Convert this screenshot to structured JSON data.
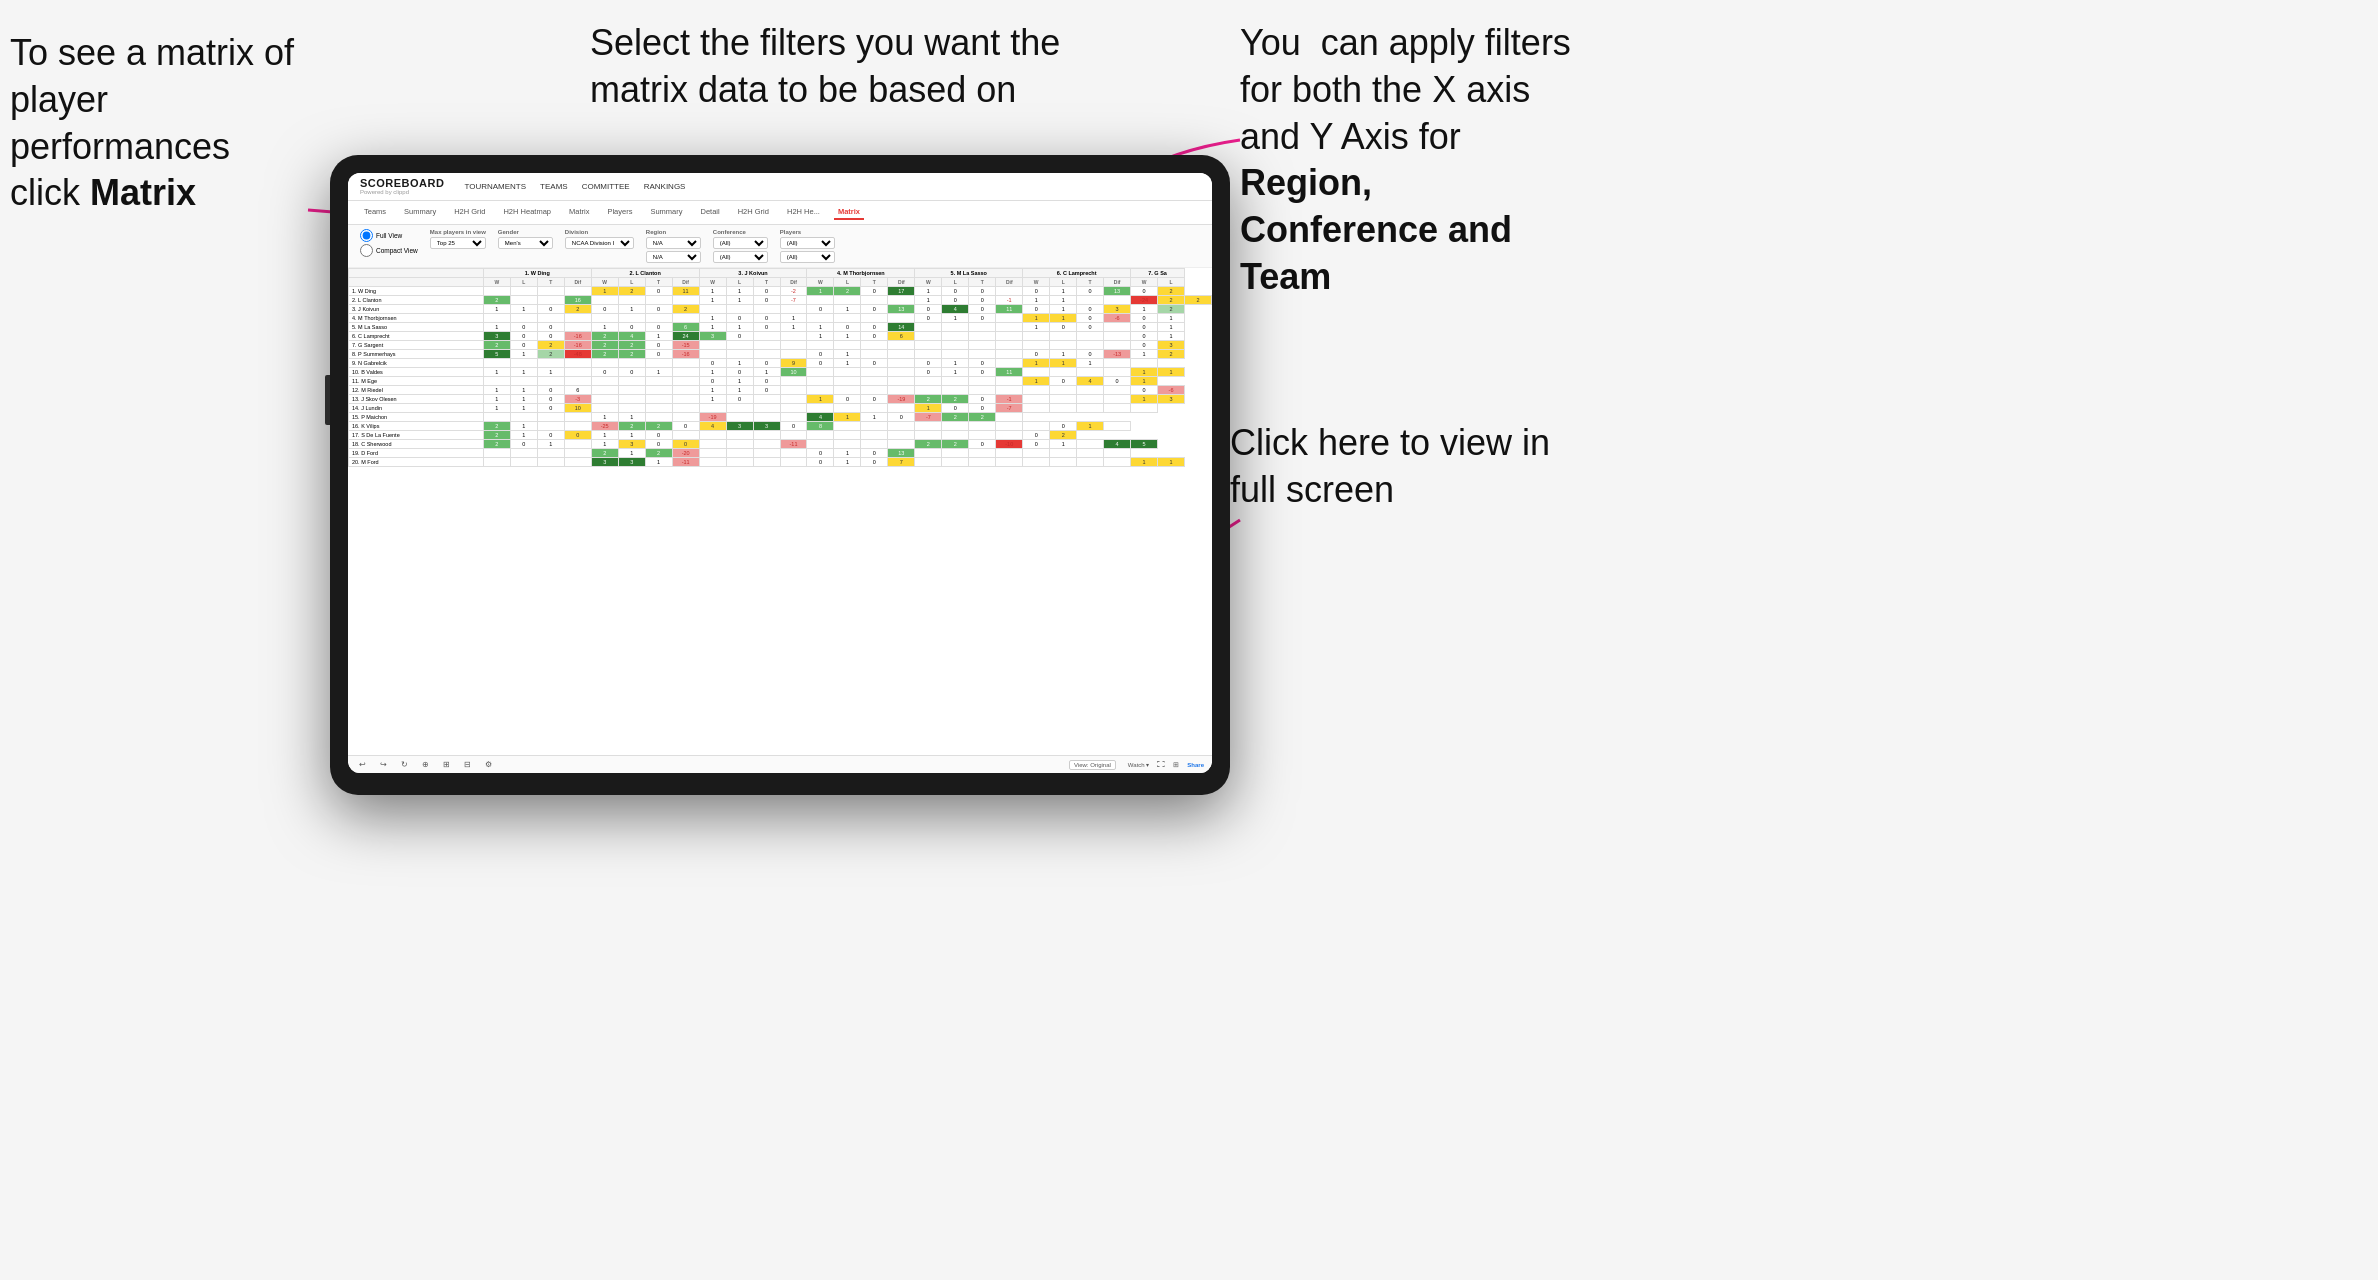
{
  "annotations": {
    "left": {
      "line1": "To see a matrix of",
      "line2": "player performances",
      "line3_pre": "click ",
      "line3_bold": "Matrix"
    },
    "center": {
      "text": "Select the filters you want the matrix data to be based on"
    },
    "right": {
      "line1": "You  can apply filters for both the X axis and Y Axis for ",
      "bold1": "Region, Conference and Team"
    },
    "bottom_right": {
      "text": "Click here to view in full screen"
    }
  },
  "app": {
    "logo": "SCOREBOARD",
    "powered_by": "Powered by clippd",
    "nav": [
      "TOURNAMENTS",
      "TEAMS",
      "COMMITTEE",
      "RANKINGS"
    ]
  },
  "sub_nav": {
    "tabs": [
      "Teams",
      "Summary",
      "H2H Grid",
      "H2H Heatmap",
      "Matrix",
      "Players",
      "Summary",
      "Detail",
      "H2H Grid",
      "H2H He...",
      "Matrix"
    ]
  },
  "filters": {
    "view_options": [
      "Full View",
      "Compact View"
    ],
    "max_players": {
      "label": "Max players in view",
      "value": "Top 25"
    },
    "gender": {
      "label": "Gender",
      "value": "Men's"
    },
    "division": {
      "label": "Division",
      "value": "NCAA Division I"
    },
    "region": {
      "label": "Region",
      "value1": "N/A",
      "value2": "N/A"
    },
    "conference": {
      "label": "Conference",
      "value1": "(All)",
      "value2": "(All)"
    },
    "players": {
      "label": "Players",
      "value1": "(All)",
      "value2": "(All)"
    }
  },
  "matrix": {
    "column_headers": [
      "1. W Ding",
      "2. L Clanton",
      "3. J Koivun",
      "4. M Thorbjornsen",
      "5. M La Sasso",
      "6. C Lamprecht",
      "7. G Sa"
    ],
    "sub_headers": [
      "W",
      "L",
      "T",
      "Dif"
    ],
    "rows": [
      {
        "name": "1. W Ding",
        "cells": [
          "",
          "",
          "",
          "",
          "1",
          "2",
          "0",
          "11",
          "1",
          "1",
          "0",
          "-2",
          "1",
          "2",
          "0",
          "17",
          "1",
          "0",
          "0",
          "",
          "0",
          "1",
          "0",
          "13",
          "0",
          "2"
        ]
      },
      {
        "name": "2. L Clanton",
        "cells": [
          "2",
          "",
          "",
          "16",
          "",
          "",
          "",
          "",
          "1",
          "1",
          "0",
          "-7",
          "",
          "",
          "",
          "",
          "1",
          "0",
          "0",
          "-1",
          "1",
          "1",
          "",
          "",
          "-24",
          "2",
          "2"
        ]
      },
      {
        "name": "3. J Koivun",
        "cells": [
          "1",
          "1",
          "0",
          "2",
          "0",
          "1",
          "0",
          "2",
          "",
          "",
          "",
          "",
          "0",
          "1",
          "0",
          "13",
          "0",
          "4",
          "0",
          "11",
          "0",
          "1",
          "0",
          "3",
          "1",
          "2"
        ]
      },
      {
        "name": "4. M Thorbjornsen",
        "cells": [
          "",
          "",
          "",
          "",
          "",
          "",
          "",
          "",
          "1",
          "0",
          "0",
          "1",
          "",
          "",
          "",
          "",
          "0",
          "1",
          "0",
          "",
          "1",
          "1",
          "0",
          "-6",
          "0",
          "1"
        ]
      },
      {
        "name": "5. M La Sasso",
        "cells": [
          "1",
          "0",
          "0",
          "",
          "1",
          "0",
          "0",
          "6",
          "1",
          "1",
          "0",
          "1",
          "1",
          "0",
          "0",
          "14",
          "",
          "",
          "",
          "",
          "1",
          "0",
          "0",
          "",
          "0",
          "1"
        ]
      },
      {
        "name": "6. C Lamprecht",
        "cells": [
          "3",
          "0",
          "0",
          "-16",
          "2",
          "4",
          "1",
          "24",
          "3",
          "0",
          "",
          "",
          "1",
          "1",
          "0",
          "6",
          "",
          "",
          "",
          "",
          "",
          "",
          "",
          "",
          "0",
          "1"
        ]
      },
      {
        "name": "7. G Sargent",
        "cells": [
          "2",
          "0",
          "2",
          "-16",
          "2",
          "2",
          "0",
          "-15",
          "",
          "",
          "",
          "",
          "",
          "",
          "",
          "",
          "",
          "",
          "",
          "",
          "",
          "",
          "",
          "",
          "0",
          "3"
        ]
      },
      {
        "name": "8. P Summerhays",
        "cells": [
          "5",
          "1",
          "2",
          "-48",
          "2",
          "2",
          "0",
          "-16",
          "",
          "",
          "",
          "",
          "0",
          "1",
          "",
          "",
          "",
          "",
          "",
          "",
          "0",
          "1",
          "0",
          "-13",
          "1",
          "2"
        ]
      },
      {
        "name": "9. N Gabrelcik",
        "cells": [
          "",
          "",
          "",
          "",
          "",
          "",
          "",
          "",
          "0",
          "1",
          "0",
          "9",
          "0",
          "1",
          "0",
          "",
          "0",
          "1",
          "0",
          "",
          "1",
          "1",
          "1",
          "",
          ""
        ]
      },
      {
        "name": "10. B Valdes",
        "cells": [
          "1",
          "1",
          "1",
          "",
          "0",
          "0",
          "1",
          "",
          "1",
          "0",
          "1",
          "10",
          "",
          "",
          "",
          "",
          "0",
          "1",
          "0",
          "11",
          "",
          "",
          "",
          "",
          "1",
          "1"
        ]
      },
      {
        "name": "11. M Ege",
        "cells": [
          "",
          "",
          "",
          "",
          "",
          "",
          "",
          "",
          "0",
          "1",
          "0",
          "",
          "",
          "",
          "",
          "",
          "",
          "",
          "",
          "",
          "1",
          "0",
          "4",
          "0",
          "1"
        ]
      },
      {
        "name": "12. M Riedel",
        "cells": [
          "1",
          "1",
          "0",
          "6",
          "",
          "",
          "",
          "",
          "1",
          "1",
          "0",
          "",
          "",
          "",
          "",
          "",
          "",
          "",
          "",
          "",
          "",
          "",
          "",
          "",
          "0",
          "-6"
        ]
      },
      {
        "name": "13. J Skov Olesen",
        "cells": [
          "1",
          "1",
          "0",
          "-3",
          "",
          "",
          "",
          "",
          "1",
          "0",
          "",
          "",
          "1",
          "0",
          "0",
          "-19",
          "2",
          "2",
          "0",
          "-1",
          "",
          "",
          "",
          "",
          "1",
          "3"
        ]
      },
      {
        "name": "14. J Lundin",
        "cells": [
          "1",
          "1",
          "0",
          "10",
          "",
          "",
          "",
          "",
          "",
          "",
          "",
          "",
          "",
          "",
          "",
          "",
          "1",
          "0",
          "0",
          "-7",
          "",
          "",
          "",
          "",
          ""
        ]
      },
      {
        "name": "15. P Maichon",
        "cells": [
          "",
          "",
          "",
          "",
          "1",
          "1",
          "",
          "",
          "-19",
          "",
          "",
          "",
          "4",
          "1",
          "1",
          "0",
          "-7",
          "2",
          "2",
          ""
        ]
      },
      {
        "name": "16. K Vilips",
        "cells": [
          "2",
          "1",
          "",
          "",
          "-25",
          "2",
          "2",
          "0",
          "4",
          "3",
          "3",
          "0",
          "8",
          "",
          "",
          "",
          "",
          "",
          "",
          "",
          "",
          "0",
          "1",
          ""
        ]
      },
      {
        "name": "17. S De La Fuente",
        "cells": [
          "2",
          "1",
          "0",
          "0",
          "1",
          "1",
          "0",
          "",
          "",
          "",
          "",
          "",
          "",
          "",
          "",
          "",
          "",
          "",
          "",
          "",
          "0",
          "2"
        ]
      },
      {
        "name": "18. C Sherwood",
        "cells": [
          "2",
          "0",
          "1",
          "",
          "1",
          "3",
          "0",
          "0",
          "",
          "",
          "",
          "-11",
          "",
          "",
          "",
          "",
          "2",
          "2",
          "0",
          "-10",
          "0",
          "1",
          "",
          "4",
          "5"
        ]
      },
      {
        "name": "19. D Ford",
        "cells": [
          "",
          "",
          "",
          "",
          "2",
          "1",
          "2",
          "-20",
          "",
          "",
          "",
          "",
          "0",
          "1",
          "0",
          "13",
          "",
          "",
          "",
          "",
          "",
          "",
          "",
          ""
        ]
      },
      {
        "name": "20. M Ford",
        "cells": [
          "",
          "",
          "",
          "",
          "3",
          "3",
          "1",
          "-11",
          "",
          "",
          "",
          "",
          "0",
          "1",
          "0",
          "7",
          "",
          "",
          "",
          "",
          "",
          "",
          "",
          "",
          "1",
          "1"
        ]
      }
    ]
  },
  "toolbar": {
    "view_label": "View: Original",
    "watch_label": "Watch ▾",
    "share_label": "Share"
  },
  "colors": {
    "red_arrow": "#e91e8c",
    "active_tab": "#e53935",
    "brand": "#1a1a1a"
  }
}
